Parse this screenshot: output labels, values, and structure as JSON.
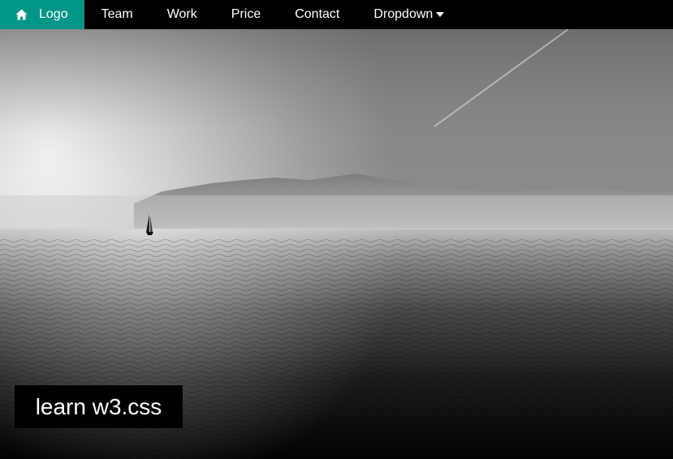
{
  "nav": {
    "logo": {
      "label": "Logo",
      "icon": "home-icon",
      "accent": "#009688"
    },
    "items": [
      {
        "label": "Team"
      },
      {
        "label": "Work"
      },
      {
        "label": "Price"
      },
      {
        "label": "Contact"
      }
    ],
    "dropdown": {
      "label": "Dropdown",
      "icon": "caret-down-icon"
    }
  },
  "hero": {
    "caption": "learn w3.css"
  }
}
